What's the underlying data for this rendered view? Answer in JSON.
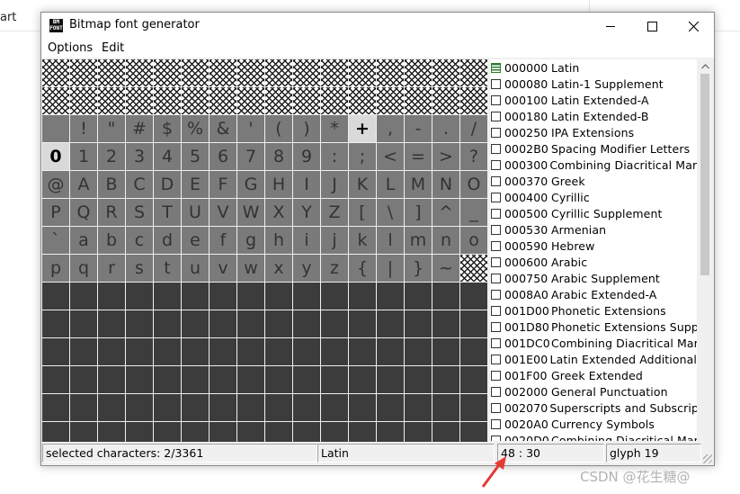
{
  "background_app": {
    "tab_text": "art"
  },
  "window": {
    "title": "Bitmap font generator",
    "icon_text": "BM\nFONT"
  },
  "menu": [
    {
      "label": "Options"
    },
    {
      "label": "Edit"
    }
  ],
  "grid": {
    "rows": [
      [
        "x",
        "x",
        "x",
        "x",
        "x",
        "x",
        "x",
        "x",
        "x",
        "x",
        "x",
        "x",
        "x",
        "x",
        "x",
        "x"
      ],
      [
        "x",
        "x",
        "x",
        "x",
        "x",
        "x",
        "x",
        "x",
        "x",
        "x",
        "x",
        "x",
        "x",
        "x",
        "x",
        "x"
      ],
      [
        " ",
        "!",
        "\"",
        "#",
        "$",
        "%",
        "&",
        "'",
        "(",
        ")",
        "*",
        "+",
        ",",
        "-",
        ".",
        "/"
      ],
      [
        "0",
        "1",
        "2",
        "3",
        "4",
        "5",
        "6",
        "7",
        "8",
        "9",
        ":",
        ";",
        "<",
        "=",
        ">",
        "?"
      ],
      [
        "@",
        "A",
        "B",
        "C",
        "D",
        "E",
        "F",
        "G",
        "H",
        "I",
        "J",
        "K",
        "L",
        "M",
        "N",
        "O"
      ],
      [
        "P",
        "Q",
        "R",
        "S",
        "T",
        "U",
        "V",
        "W",
        "X",
        "Y",
        "Z",
        "[",
        "\\",
        "]",
        "^",
        "_"
      ],
      [
        "`",
        "a",
        "b",
        "c",
        "d",
        "e",
        "f",
        "g",
        "h",
        "i",
        "j",
        "k",
        "l",
        "m",
        "n",
        "o"
      ],
      [
        "p",
        "q",
        "r",
        "s",
        "t",
        "u",
        "v",
        "w",
        "x",
        "y",
        "z",
        "{",
        "|",
        "}",
        "~",
        "x"
      ]
    ],
    "selected": [
      "+",
      "0"
    ],
    "empty_rows": 7
  },
  "subsets": [
    {
      "code": "000000",
      "name": "Latin",
      "state": "partial"
    },
    {
      "code": "000080",
      "name": "Latin-1 Supplement",
      "state": "off"
    },
    {
      "code": "000100",
      "name": "Latin Extended-A",
      "state": "off"
    },
    {
      "code": "000180",
      "name": "Latin Extended-B",
      "state": "off"
    },
    {
      "code": "000250",
      "name": "IPA Extensions",
      "state": "off"
    },
    {
      "code": "0002B0",
      "name": "Spacing Modifier Letters",
      "state": "off"
    },
    {
      "code": "000300",
      "name": "Combining Diacritical Marks",
      "state": "off"
    },
    {
      "code": "000370",
      "name": "Greek",
      "state": "off"
    },
    {
      "code": "000400",
      "name": "Cyrillic",
      "state": "off"
    },
    {
      "code": "000500",
      "name": "Cyrillic Supplement",
      "state": "off"
    },
    {
      "code": "000530",
      "name": "Armenian",
      "state": "off"
    },
    {
      "code": "000590",
      "name": "Hebrew",
      "state": "off"
    },
    {
      "code": "000600",
      "name": "Arabic",
      "state": "off"
    },
    {
      "code": "000750",
      "name": "Arabic Supplement",
      "state": "off"
    },
    {
      "code": "0008A0",
      "name": "Arabic Extended-A",
      "state": "off"
    },
    {
      "code": "001D00",
      "name": "Phonetic Extensions",
      "state": "off"
    },
    {
      "code": "001D80",
      "name": "Phonetic Extensions Supple.",
      "state": "off"
    },
    {
      "code": "001DC0",
      "name": "Combining Diacritical Marks",
      "state": "off"
    },
    {
      "code": "001E00",
      "name": "Latin Extended Additional",
      "state": "off"
    },
    {
      "code": "001F00",
      "name": "Greek Extended",
      "state": "off"
    },
    {
      "code": "002000",
      "name": "General Punctuation",
      "state": "off"
    },
    {
      "code": "002070",
      "name": "Superscripts and Subscripts",
      "state": "off"
    },
    {
      "code": "0020A0",
      "name": "Currency Symbols",
      "state": "off"
    },
    {
      "code": "0020D0",
      "name": "Combining Diacritical Marks",
      "state": "off"
    }
  ],
  "status": {
    "selected": "selected characters: 2/3361",
    "subset": "Latin",
    "coords": "48 : 30",
    "glyph": "glyph 19"
  },
  "watermark": "CSDN @花生糖@",
  "colors": {
    "annotation_arrow": "#e53935",
    "subset_checked": "#2e7d32"
  }
}
